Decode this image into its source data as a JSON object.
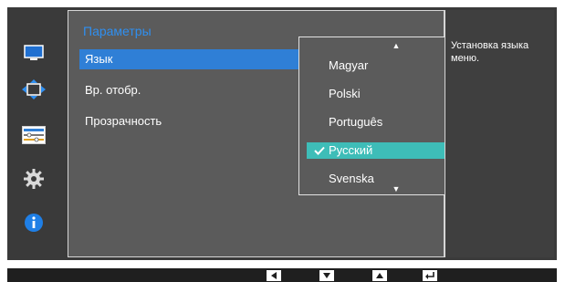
{
  "menu": {
    "title": "Параметры",
    "items": [
      {
        "label": "Язык",
        "selected": true
      },
      {
        "label": "Вр. отобр.",
        "selected": false
      },
      {
        "label": "Прозрачность",
        "selected": false
      }
    ]
  },
  "dropdown": {
    "options": [
      "Magyar",
      "Polski",
      "Português",
      "Русский",
      "Svenska"
    ],
    "selected": "Русский"
  },
  "help": {
    "text": "Установка языка меню."
  },
  "icons": [
    {
      "name": "picture-icon"
    },
    {
      "name": "screen-size-icon"
    },
    {
      "name": "onscreen-display-icon"
    },
    {
      "name": "settings-gear-icon"
    },
    {
      "name": "info-icon"
    }
  ],
  "buttons": [
    {
      "name": "left-arrow-button"
    },
    {
      "name": "down-arrow-button"
    },
    {
      "name": "up-arrow-button"
    },
    {
      "name": "enter-button"
    }
  ],
  "colors": {
    "accent": "#2f7fd6",
    "selected_option": "#3ebdb8",
    "title": "#2f8ff0"
  }
}
